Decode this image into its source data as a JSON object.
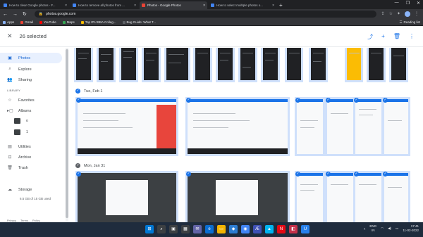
{
  "browser": {
    "tabs": [
      {
        "label": "How to clear Google photos - F...",
        "color": "#4285f4",
        "active": false
      },
      {
        "label": "How to remove all photos from ...",
        "color": "#4285f4",
        "active": false
      },
      {
        "label": "Photos - Google Photos",
        "color": "#ea4335",
        "active": true
      },
      {
        "label": "How to select multiple photos o...",
        "color": "#4285f4",
        "active": false
      }
    ],
    "url": "photos.google.com",
    "bookmarks": [
      {
        "label": "Apps",
        "color": "#8ab4f8"
      },
      {
        "label": "Gmail",
        "color": "#ea4335"
      },
      {
        "label": "YouTube",
        "color": "#ff0000"
      },
      {
        "label": "Maps",
        "color": "#34a853"
      },
      {
        "label": "Top IPU BBA Colleg...",
        "color": "#fbbc04"
      },
      {
        "label": "Bug Guide: What T...",
        "color": "#5f6368"
      }
    ],
    "reading_list": "Reading list"
  },
  "selection": {
    "count_label": "26 selected"
  },
  "sidebar": {
    "items": [
      {
        "label": "Photos",
        "icon": "photos-icon"
      },
      {
        "label": "Explore",
        "icon": "search-icon"
      },
      {
        "label": "Sharing",
        "icon": "people-icon"
      }
    ],
    "library_label": "LIBRARY",
    "library": [
      {
        "label": "Favorites",
        "icon": "star-icon"
      },
      {
        "label": "Albums",
        "icon": "album-icon"
      }
    ],
    "albums": [
      {
        "label": "o"
      },
      {
        "label": "1"
      }
    ],
    "library2": [
      {
        "label": "Utilities",
        "icon": "utilities-icon"
      },
      {
        "label": "Archive",
        "icon": "archive-icon"
      },
      {
        "label": "Trash",
        "icon": "trash-icon"
      }
    ],
    "storage_label": "Storage",
    "storage_detail": "6.5 GB of 15 GB used",
    "footer": [
      "Privacy",
      "Terms",
      "Policy"
    ]
  },
  "dates": [
    {
      "label": "Tue, Feb 1",
      "checked": true
    },
    {
      "label": "Mon, Jan 31",
      "checked": false
    }
  ],
  "taskbar": {
    "lang": "ENG",
    "region": "IN",
    "time": "17:41",
    "date": "11-02-2022"
  }
}
